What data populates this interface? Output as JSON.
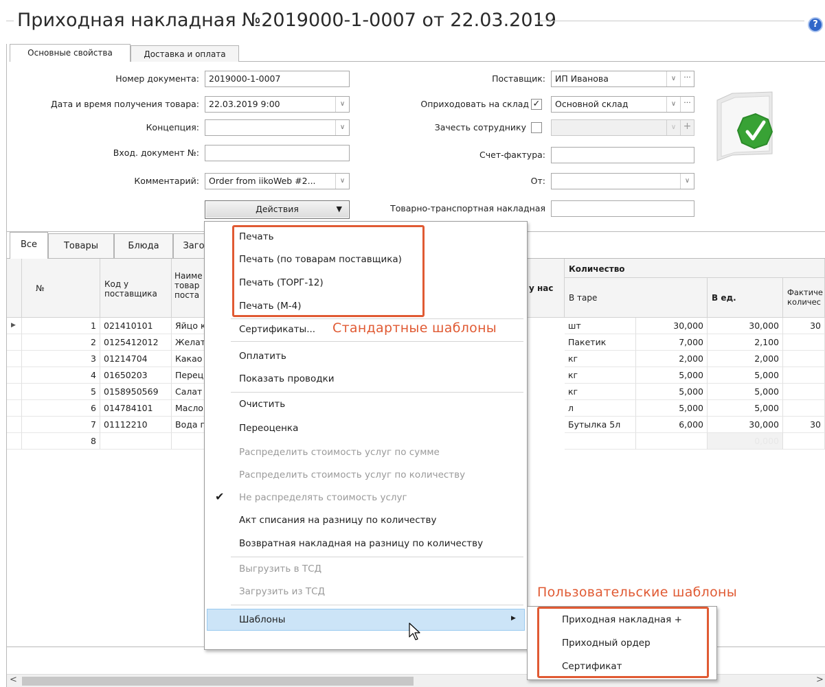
{
  "window": {
    "title": "Приходная накладная №2019000-1-0007 от 22.03.2019",
    "help_icon": "?"
  },
  "top_tabs": [
    {
      "label": "Основные свойства",
      "active": true
    },
    {
      "label": "Доставка и оплата",
      "active": false
    }
  ],
  "form": {
    "doc_number_label": "Номер документа:",
    "doc_number_value": "2019000-1-0007",
    "datetime_label": "Дата и время получения товара:",
    "datetime_value": "22.03.2019 9:00",
    "concept_label": "Концепция:",
    "concept_value": "",
    "incoming_doc_label": "Вход. документ №:",
    "incoming_doc_value": "",
    "comment_label": "Комментарий:",
    "comment_value": "Order from iikoWeb #2...",
    "supplier_label": "Поставщик:",
    "supplier_value": "ИП Иванова",
    "warehouse_label": "Оприходовать на склад",
    "warehouse_checked": "✓",
    "warehouse_value": "Основной склад",
    "employee_label": "Зачесть сотруднику",
    "employee_value": "",
    "invoice_label": "Счет-фактура:",
    "invoice_value": "",
    "from_label": "От:",
    "from_value": "",
    "waybill_label": "Товарно-транспортная накладная",
    "waybill_value": "",
    "ellipsis": "···",
    "plus": "+",
    "dropdown_arrow": "∨"
  },
  "actions_button": {
    "label": "Действия",
    "arrow": "▼"
  },
  "grid_tabs": [
    {
      "label": "Все",
      "active": true
    },
    {
      "label": "Товары",
      "active": false
    },
    {
      "label": "Блюда",
      "active": false
    },
    {
      "label": "Заго",
      "active": false
    }
  ],
  "grid": {
    "headers": {
      "num": "№",
      "supplier_code": "Код у поставщика",
      "name_partial": "Наиме товар поста",
      "ours_partial": "у нас",
      "quantity_group": "Количество",
      "in_pack": "В таре",
      "in_units": "В ед.",
      "actual_partial": "Фактиче количес"
    },
    "rows": [
      {
        "n": "1",
        "code": "021410101",
        "name": "Яйцо к",
        "pack": "шт",
        "qty": "30,000",
        "units": "30,000",
        "actual": "30"
      },
      {
        "n": "2",
        "code": "0125412012",
        "name": "Желат",
        "pack": "Пакетик",
        "qty": "7,000",
        "units": "2,100",
        "actual": ""
      },
      {
        "n": "3",
        "code": "01214704",
        "name": "Какао",
        "pack": "кг",
        "qty": "2,000",
        "units": "2,000",
        "actual": ""
      },
      {
        "n": "4",
        "code": "01650203",
        "name": "Перец",
        "pack": "кг",
        "qty": "5,000",
        "units": "5,000",
        "actual": ""
      },
      {
        "n": "5",
        "code": "0158950569",
        "name": "Салат",
        "pack": "кг",
        "qty": "5,000",
        "units": "5,000",
        "actual": ""
      },
      {
        "n": "6",
        "code": "014784101",
        "name": "Масло",
        "pack": "л",
        "qty": "5,000",
        "units": "5,000",
        "actual": ""
      },
      {
        "n": "7",
        "code": "01112210",
        "name": "Вода п",
        "pack": "Бутылка 5л",
        "qty": "6,000",
        "units": "30,000",
        "actual": "30"
      },
      {
        "n": "8",
        "code": "",
        "name": "",
        "pack": "",
        "qty": "",
        "units": "0,000",
        "actual": ""
      }
    ]
  },
  "menu": {
    "items": [
      {
        "label": "Печать",
        "disabled": false
      },
      {
        "label": "Печать (по товарам поставщика)",
        "disabled": false
      },
      {
        "label": "Печать (ТОРГ-12)",
        "disabled": false
      },
      {
        "label": "Печать (М-4)",
        "disabled": false
      },
      {
        "label": "Сертификаты...",
        "disabled": false
      },
      {
        "label": "Оплатить",
        "disabled": false
      },
      {
        "label": "Показать проводки",
        "disabled": false
      },
      {
        "label": "Очистить",
        "disabled": false
      },
      {
        "label": "Переоценка",
        "disabled": false
      },
      {
        "label": "Распределить стоимость услуг по сумме",
        "disabled": true
      },
      {
        "label": "Распределить стоимость услуг по количеству",
        "disabled": true
      },
      {
        "label": "Не распределять стоимость услуг",
        "disabled": true,
        "checked": true
      },
      {
        "label": "Акт списания на разницу по количеству",
        "disabled": false
      },
      {
        "label": "Возвратная накладная на разницу по количеству",
        "disabled": false
      },
      {
        "label": "Выгрузить в ТСД",
        "disabled": true
      },
      {
        "label": "Загрузить из ТСД",
        "disabled": true
      },
      {
        "label": "Шаблоны",
        "disabled": false,
        "submenu": true
      }
    ],
    "check_mark": "✔",
    "submenu_arrow": "▶"
  },
  "submenu": {
    "items": [
      {
        "label": "Приходная накладная +"
      },
      {
        "label": "Приходный ордер"
      },
      {
        "label": "Сертификат"
      }
    ]
  },
  "annotations": {
    "standard_templates": "Стандартные шаблоны",
    "custom_templates": "Пользовательские шаблоны",
    "color": "#e05a33"
  },
  "scroll": {
    "left_arrow": "<",
    "right_arrow": ">"
  }
}
